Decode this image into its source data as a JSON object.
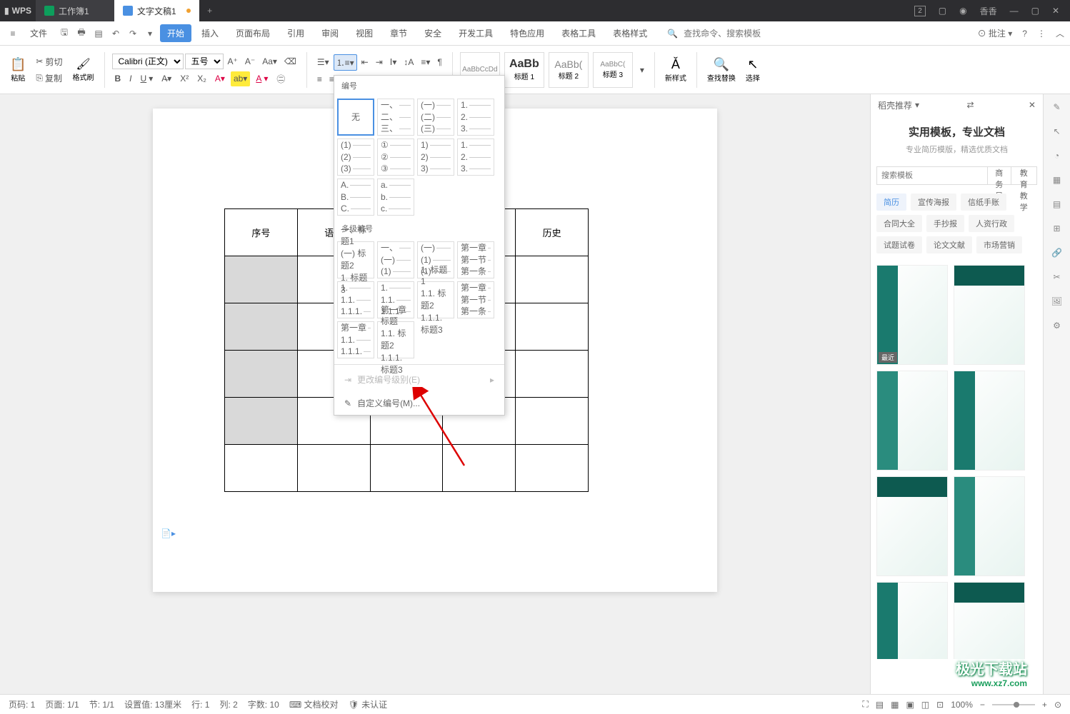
{
  "titlebar": {
    "logo": "WPS",
    "tabs": [
      {
        "label": "工作簿1",
        "icon": "green",
        "active": false
      },
      {
        "label": "文字文稿1",
        "icon": "blue",
        "active": true,
        "modified": true
      }
    ],
    "user": "香香",
    "badge": "2"
  },
  "menu": {
    "file": "文件",
    "tabs": [
      "开始",
      "插入",
      "页面布局",
      "引用",
      "审阅",
      "视图",
      "章节",
      "安全",
      "开发工具",
      "特色应用",
      "表格工具",
      "表格样式"
    ],
    "search_placeholder": "查找命令、搜索模板",
    "annotate": "批注"
  },
  "ribbon": {
    "paste": "粘贴",
    "cut": "剪切",
    "copy": "复制",
    "format_painter": "格式刷",
    "font_name": "Calibri (正文)",
    "font_size": "五号",
    "heading1": "标题 1",
    "heading2": "标题 2",
    "heading3": "标题 3",
    "preview_normal": "AaBbCcDd",
    "preview_h1": "AaBb",
    "preview_h2": "AaBb(",
    "preview_h3": "AaBbC(",
    "new_style": "新样式",
    "find_replace": "查找替换",
    "select": "选择"
  },
  "popup": {
    "title": "编号",
    "none": "无",
    "multilevel": "多级编号",
    "change_level": "更改编号级别(E)",
    "custom": "自定义编号(M)...",
    "single_options": [
      [
        "一、",
        "二、",
        "三、"
      ],
      [
        "(一)",
        "(二)",
        "(三)"
      ],
      [
        "1.",
        "2.",
        "3."
      ],
      [
        "(1)",
        "(2)",
        "(3)"
      ],
      [
        "①",
        "②",
        "③"
      ],
      [
        "1)",
        "2)",
        "3)"
      ],
      [
        "1.",
        "2.",
        "3."
      ],
      [
        "A.",
        "B.",
        "C."
      ],
      [
        "a.",
        "b.",
        "c."
      ]
    ],
    "multi_options": [
      [
        "一、标题1",
        "(一) 标题2",
        "1. 标题3"
      ],
      [
        "一、",
        "(一)",
        "(1)"
      ],
      [
        "(一)",
        "(1)",
        "(1)"
      ],
      [
        "第一章",
        "第一节",
        "第一条"
      ],
      [
        "1.",
        "1.1.",
        "1.1.1."
      ],
      [
        "1.",
        "1.1.",
        "1.1.1."
      ],
      [
        "1. 标题1",
        "1.1. 标题2",
        "1.1.1. 标题3"
      ],
      [
        "第一章",
        "第一节",
        "第一条"
      ],
      [
        "第一章",
        "1.1.",
        "1.1.1."
      ],
      [
        "第一章 标题",
        "1.1. 标题2",
        "1.1.1. 标题3"
      ]
    ]
  },
  "table": {
    "headers": [
      "序号",
      "语文",
      "",
      "",
      "历史"
    ]
  },
  "sidepanel": {
    "title": "稻壳推荐",
    "banner_title": "实用模板，专业文档",
    "banner_sub": "专业简历模版，精选优质文档",
    "search_placeholder": "搜索模板",
    "search_btns": [
      "商务风",
      "教育教学"
    ],
    "tags": [
      "简历",
      "宣传海报",
      "信纸手账",
      "合同大全",
      "手抄报",
      "人资行政",
      "试题试卷",
      "论文文献",
      "市场营销"
    ],
    "recent_badge": "最近"
  },
  "statusbar": {
    "page_num": "页码: 1",
    "page": "页面: 1/1",
    "section": "节: 1/1",
    "ruler": "设置值: 13厘米",
    "line": "行: 1",
    "col": "列: 2",
    "words": "字数: 10",
    "proof": "文档校对",
    "unauth": "未认证",
    "zoom": "100%"
  },
  "watermark": {
    "l1": "极光下载站",
    "l2": "www.xz7.com"
  }
}
